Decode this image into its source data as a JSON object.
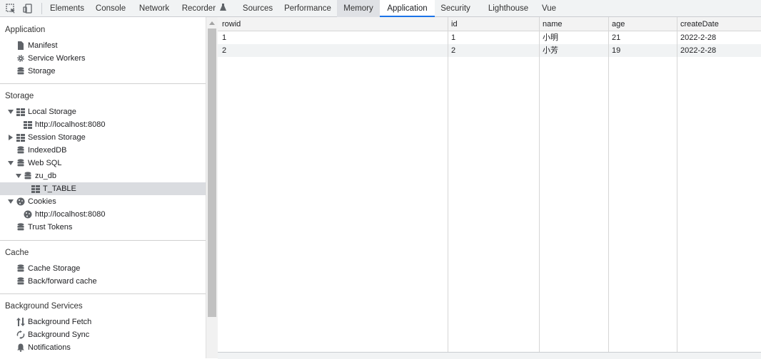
{
  "toolbar": {
    "tabs": [
      {
        "label": "Elements"
      },
      {
        "label": "Console"
      },
      {
        "label": "Network"
      },
      {
        "label": "Recorder"
      },
      {
        "label": "Sources"
      },
      {
        "label": "Performance"
      },
      {
        "label": "Memory"
      },
      {
        "label": "Application"
      },
      {
        "label": "Security"
      },
      {
        "label": "Lighthouse"
      },
      {
        "label": "Vue"
      }
    ],
    "active_tab": "Application",
    "accent": "#1a73e8"
  },
  "sidebar": {
    "application": {
      "title": "Application",
      "items": [
        {
          "label": "Manifest",
          "icon": "file-icon"
        },
        {
          "label": "Service Workers",
          "icon": "gear-icon"
        },
        {
          "label": "Storage",
          "icon": "database-icon"
        }
      ]
    },
    "storage": {
      "title": "Storage",
      "items": [
        {
          "label": "Local Storage",
          "icon": "grid-icon",
          "expanded": true
        },
        {
          "label": "http://localhost:8080",
          "icon": "grid-icon"
        },
        {
          "label": "Session Storage",
          "icon": "grid-icon",
          "expanded": false
        },
        {
          "label": "IndexedDB",
          "icon": "database-icon"
        },
        {
          "label": "Web SQL",
          "icon": "database-icon",
          "expanded": true
        },
        {
          "label": "zu_db",
          "icon": "database-icon",
          "expanded": true
        },
        {
          "label": "T_TABLE",
          "icon": "grid-icon",
          "selected": true
        },
        {
          "label": "Cookies",
          "icon": "cookie-icon",
          "expanded": true
        },
        {
          "label": "http://localhost:8080",
          "icon": "cookie-icon"
        },
        {
          "label": "Trust Tokens",
          "icon": "database-icon"
        }
      ]
    },
    "cache": {
      "title": "Cache",
      "items": [
        {
          "label": "Cache Storage",
          "icon": "database-icon"
        },
        {
          "label": "Back/forward cache",
          "icon": "database-icon"
        }
      ]
    },
    "background": {
      "title": "Background Services",
      "items": [
        {
          "label": "Background Fetch",
          "icon": "arrows-updown-icon"
        },
        {
          "label": "Background Sync",
          "icon": "sync-icon"
        },
        {
          "label": "Notifications",
          "icon": "bell-icon"
        }
      ]
    }
  },
  "table": {
    "columns": [
      "rowid",
      "id",
      "name",
      "age",
      "createDate"
    ],
    "rows": [
      [
        "1",
        "1",
        "小明",
        "21",
        "2022-2-28"
      ],
      [
        "2",
        "2",
        "小芳",
        "19",
        "2022-2-28"
      ]
    ]
  }
}
